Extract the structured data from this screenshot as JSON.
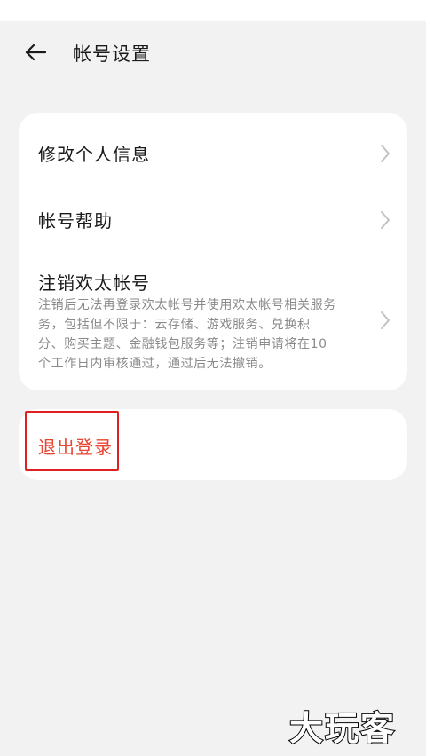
{
  "header": {
    "title": "帐号设置",
    "back_icon": "arrow-left-icon"
  },
  "menu": {
    "items": [
      {
        "label": "修改个人信息",
        "icon": "chevron-right-icon"
      },
      {
        "label": "帐号帮助",
        "icon": "chevron-right-icon"
      },
      {
        "label": "注销欢太帐号",
        "description_lines": [
          "注销后无法再登录欢太帐号并使用欢太帐号相关服务",
          "务，包括但不限于：云存储、游戏服务、兑换积",
          "分、购买主题、金融钱包服务等；注销申请将在10",
          "个工作日内审核通过，通过后无法撤销。"
        ],
        "icon": "chevron-right-icon"
      }
    ]
  },
  "logout": {
    "label": "退出登录",
    "color": "#e8442f"
  },
  "watermark": {
    "text": "大玩客"
  },
  "colors": {
    "background": "#f2f2f2",
    "card": "#ffffff",
    "highlight_border": "#e02020"
  }
}
